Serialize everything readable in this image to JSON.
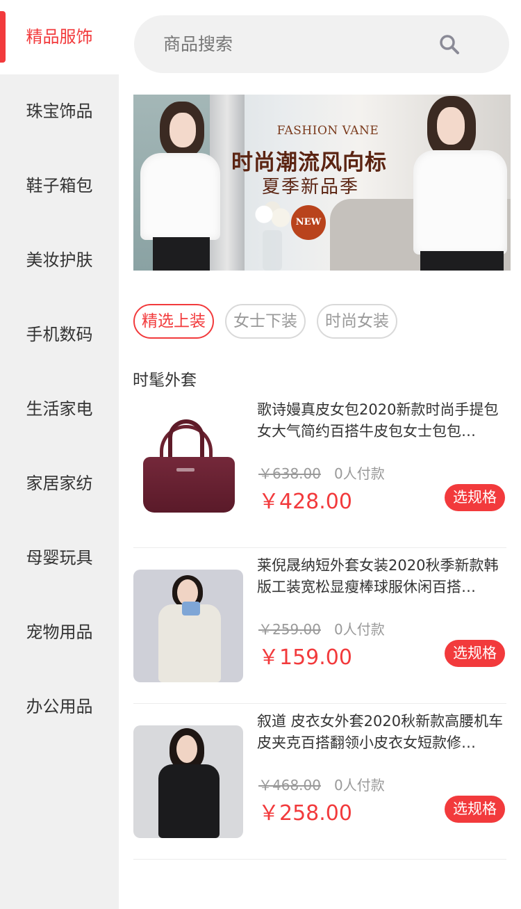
{
  "sidebar": {
    "items": [
      {
        "label": "精品服饰",
        "active": true
      },
      {
        "label": "珠宝饰品"
      },
      {
        "label": "鞋子箱包"
      },
      {
        "label": "美妆护肤"
      },
      {
        "label": "手机数码"
      },
      {
        "label": "生活家电"
      },
      {
        "label": "家居家纺"
      },
      {
        "label": "母婴玩具"
      },
      {
        "label": "宠物用品"
      },
      {
        "label": "办公用品"
      }
    ]
  },
  "search": {
    "placeholder": "商品搜索",
    "icon": "search-icon"
  },
  "banner": {
    "subtitle_en": "FASHION VANE",
    "title": "时尚潮流风向标",
    "subtitle": "夏季新品季",
    "badge": "NEW"
  },
  "tabs": [
    {
      "label": "精选上装",
      "active": true
    },
    {
      "label": "女士下装"
    },
    {
      "label": "时尚女装"
    }
  ],
  "section": {
    "title": "时髦外套"
  },
  "products": [
    {
      "name": "歌诗嫚真皮女包2020新款时尚手提包女大气简约百搭牛皮包女士包包…",
      "original_price": "￥638.00",
      "sold": "0人付款",
      "price": "￥428.00",
      "button": "选规格"
    },
    {
      "name": "莱倪晟纳短外套女装2020秋季新款韩版工装宽松显瘦棒球服休闲百搭…",
      "original_price": "￥259.00",
      "sold": "0人付款",
      "price": "￥159.00",
      "button": "选规格"
    },
    {
      "name": "叙道 皮衣女外套2020秋新款高腰机车皮夹克百搭翻领小皮衣女短款修…",
      "original_price": "￥468.00",
      "sold": "0人付款",
      "price": "￥258.00",
      "button": "选规格"
    }
  ],
  "colors": {
    "accent": "#f23a3c",
    "sidebar_bg": "#f0f0f0",
    "search_bg": "#f1f1f1"
  }
}
